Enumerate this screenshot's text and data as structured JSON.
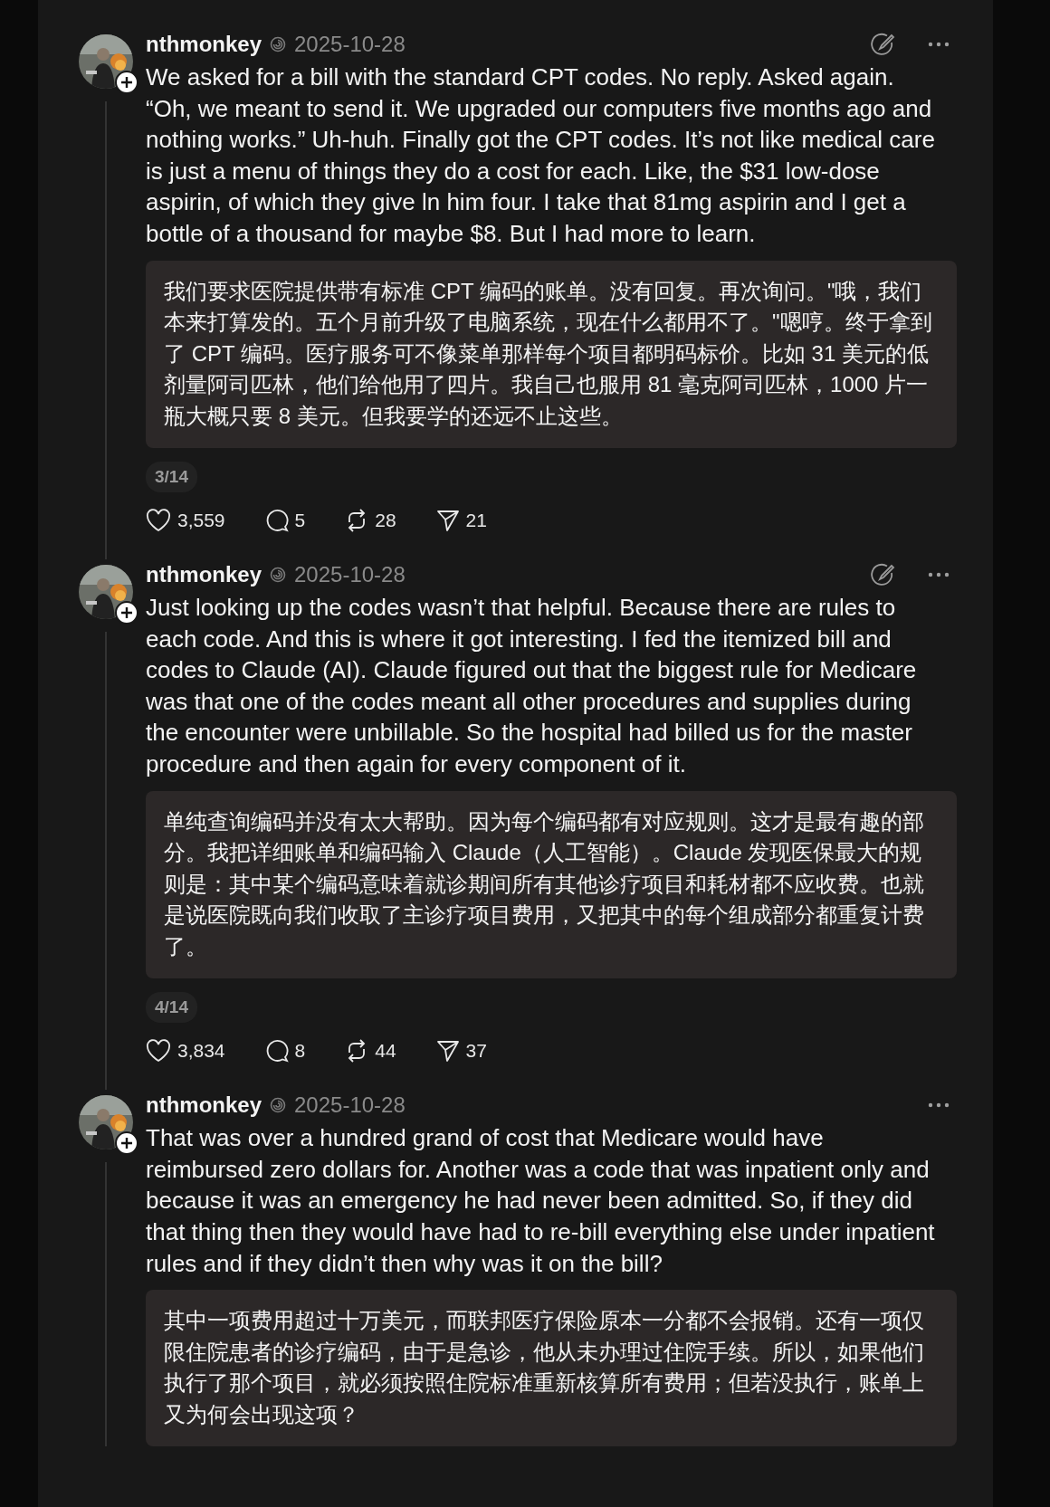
{
  "posts": [
    {
      "author": "nthmonkey",
      "date": "2025-10-28",
      "edit_button": true,
      "text": "We asked for a bill with the standard CPT codes. No reply. Asked again. “Oh, we meant to send it. We upgraded our computers five months ago and nothing works.” Uh-huh. Finally got the CPT codes. It’s not like medical care is just a menu of things they do a cost for each. Like, the $31 low-dose aspirin, of which they give ln him four. I take that 81mg aspirin and I get a bottle of a thousand for maybe $8. But I had more to learn.",
      "translation": "我们要求医院提供带有标准 CPT 编码的账单。没有回复。再次询问。\"哦，我们本来打算发的。五个月前升级了电脑系统，现在什么都用不了。\"嗯哼。终于拿到了 CPT 编码。医疗服务可不像菜单那样每个项目都明码标价。比如 31 美元的低剂量阿司匹林，他们给他用了四片。我自己也服用 81 毫克阿司匹林，1000 片一瓶大概只要 8 美元。但我要学的还远不止这些。",
      "page": "3/14",
      "stats": {
        "likes": "3,559",
        "replies": "5",
        "reposts": "28",
        "shares": "21"
      }
    },
    {
      "author": "nthmonkey",
      "date": "2025-10-28",
      "edit_button": true,
      "text": "Just looking up the codes wasn’t that helpful. Because there are rules to each code. And this is where it got interesting. I fed the itemized bill and codes to Claude (AI). Claude figured out that the biggest rule for Medicare was that one of the codes meant all other procedures and supplies during the encounter were unbillable. So the hospital had billed us for the master procedure and then again for every component of it.",
      "translation": "单纯查询编码并没有太大帮助。因为每个编码都有对应规则。这才是最有趣的部分。我把详细账单和编码输入 Claude（人工智能）。Claude 发现医保最大的规则是：其中某个编码意味着就诊期间所有其他诊疗项目和耗材都不应收费。也就是说医院既向我们收取了主诊疗项目费用，又把其中的每个组成部分都重复计费了。",
      "page": "4/14",
      "stats": {
        "likes": "3,834",
        "replies": "8",
        "reposts": "44",
        "shares": "37"
      }
    },
    {
      "author": "nthmonkey",
      "date": "2025-10-28",
      "edit_button": false,
      "text": "That was over a hundred grand of cost that Medicare would have reimbursed zero dollars for. Another was a code that was inpatient only and because it was an emergency he had never been admitted. So, if they did that thing then they would have had to re-bill everything else under inpatient rules and if they didn’t then why was it on the bill?",
      "translation": "其中一项费用超过十万美元，而联邦医疗保险原本一分都不会报销。还有一项仅限住院患者的诊疗编码，由于是急诊，他从未办理过住院手续。所以，如果他们执行了那个项目，就必须按照住院标准重新核算所有费用；但若没执行，账单上又为何会出现这项？"
    }
  ]
}
